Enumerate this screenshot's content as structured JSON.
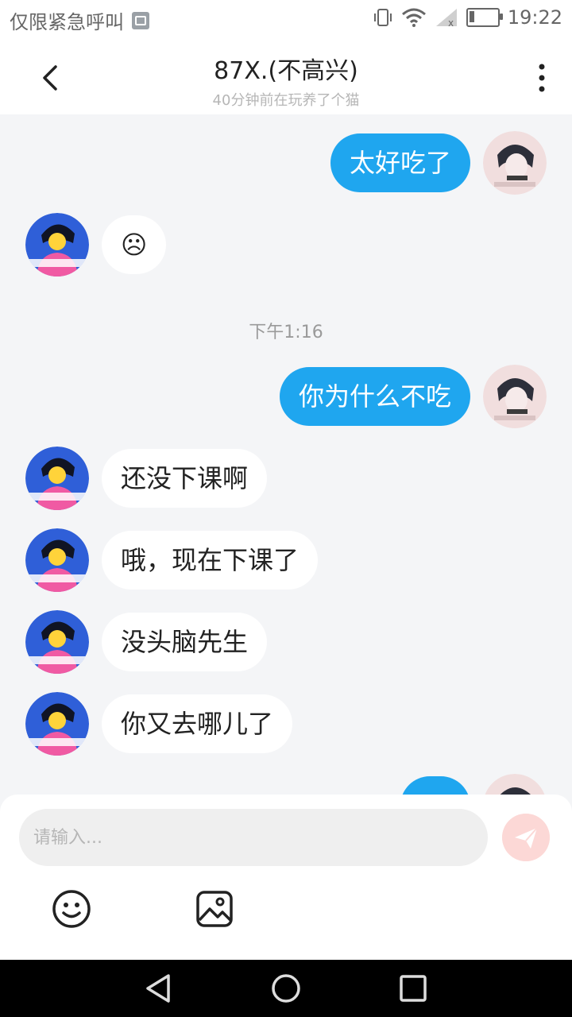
{
  "status_bar": {
    "carrier": "仅限紧急呼叫",
    "time": "19:22",
    "icons": [
      "image-icon",
      "vibrate-icon",
      "wifi-icon",
      "signal-icon",
      "battery-icon"
    ]
  },
  "header": {
    "title": "87X.(不高兴)",
    "subtitle": "40分钟前在玩养了个猫",
    "back_icon": "chevron-left-icon",
    "more_icon": "more-vertical-icon"
  },
  "messages": [
    {
      "sender": "me",
      "text": "太好吃了"
    },
    {
      "sender": "them",
      "text": "☹"
    },
    {
      "type": "time",
      "text": "下午1:16"
    },
    {
      "sender": "me",
      "text": "你为什么不吃"
    },
    {
      "sender": "them",
      "text": "还没下课啊"
    },
    {
      "sender": "them",
      "text": "哦，现在下课了"
    },
    {
      "sender": "them",
      "text": "没头脑先生"
    },
    {
      "sender": "them",
      "text": "你又去哪儿了"
    }
  ],
  "composer": {
    "placeholder": "请输入...",
    "value": "",
    "send_icon": "send-icon",
    "tools": [
      "emoji-icon",
      "image-icon"
    ]
  },
  "colors": {
    "accent": "#1fa6ef",
    "background": "#f4f5f7",
    "send_button": "#fcd8d6"
  }
}
